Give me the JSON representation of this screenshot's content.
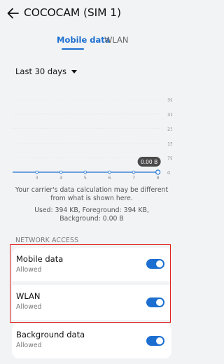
{
  "header": {
    "title": "COCOCAM (SIM 1)",
    "back_icon": "arrow-left-icon"
  },
  "tabs": [
    {
      "label": "Mobile data",
      "selected": true
    },
    {
      "label": "WLAN",
      "selected": false
    }
  ],
  "period": {
    "label": "Last 30 days",
    "icon": "caret-down-icon"
  },
  "chart_data": {
    "type": "line",
    "x": [
      3,
      4,
      5,
      6,
      7,
      8
    ],
    "series": [
      {
        "values": [
          0,
          0,
          0,
          0,
          0,
          0
        ]
      }
    ],
    "y_ticks": [
      "394",
      "316",
      "237",
      "158",
      "79",
      "0"
    ],
    "ylim": [
      0,
      394
    ],
    "tooltip": "0.00 B",
    "grid": true,
    "accent": "#1c6fd1"
  },
  "note": "Your carrier's data calculation may be different from what is shown here.",
  "usage": "Used: 394 KB, Foreground: 394 KB, Background: 0.00 B",
  "section": "NETWORK ACCESS",
  "access": [
    {
      "label": "Mobile data",
      "status": "Allowed",
      "enabled": true
    },
    {
      "label": "WLAN",
      "status": "Allowed",
      "enabled": true
    },
    {
      "label": "Background data",
      "status": "Allowed",
      "enabled": true
    }
  ],
  "colors": {
    "accent": "#1c6fd1",
    "highlight": "#e0201c",
    "background": "#f1f3f5"
  }
}
